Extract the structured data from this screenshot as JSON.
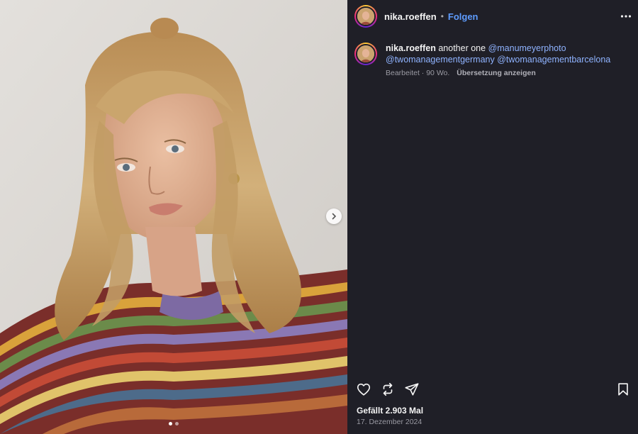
{
  "post": {
    "username": "nika.roeffen",
    "separator": "•",
    "follow_label": "Folgen",
    "image": {
      "alt_icon": "portrait-photo",
      "carousel_dots": 2,
      "active_dot": 1
    }
  },
  "caption": {
    "username": "nika.roeffen",
    "text": "another one",
    "mentions": [
      "@manumeyerphoto",
      "@twomanagementgermany",
      "@twomanagementbarcelona"
    ],
    "edited_label": "Bearbeitet",
    "meta_sep": " · ",
    "age": "90 Wo.",
    "translate_label": "Übersetzung anzeigen"
  },
  "stats": {
    "likes": "Gefällt 2.903 Mal",
    "date": "17. Dezember 2024"
  },
  "icons": {
    "like": "heart-icon",
    "repost": "repost-icon",
    "share": "share-icon",
    "save": "bookmark-icon",
    "more": "more-icon",
    "next": "chevron-right-icon"
  },
  "colors": {
    "background": "#1f1f27",
    "link": "#5e9cff",
    "mention": "#8fb3ff"
  }
}
